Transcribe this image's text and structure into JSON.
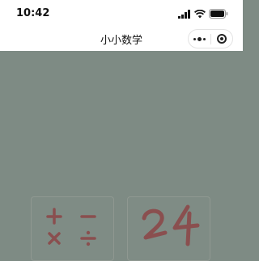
{
  "status_bar": {
    "time": "10:42"
  },
  "nav": {
    "title": "小小数学"
  },
  "tiles": {
    "operators": {
      "symbols": "+ − × ÷"
    },
    "game24": {
      "text": "24"
    }
  },
  "colors": {
    "background": "#7e8b84",
    "accent": "#8a4f4f",
    "header": "#ffffff"
  }
}
